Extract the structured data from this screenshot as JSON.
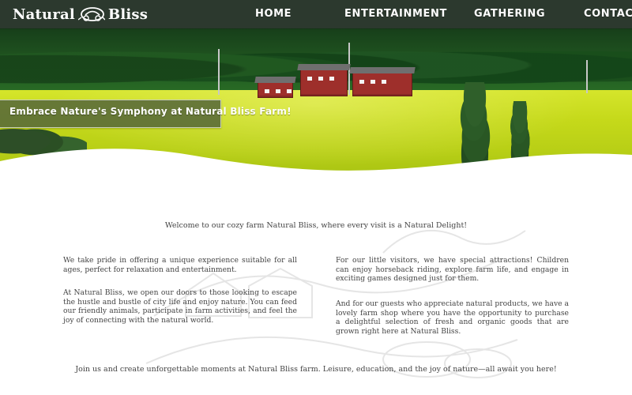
{
  "header": {
    "logo": {
      "left_text": "Natural",
      "right_text": "Bliss",
      "icon": "farm-wagon-icon"
    },
    "nav": [
      {
        "label": "HOME"
      },
      {
        "label": "ENTERTAINMENT"
      },
      {
        "label": "GATHERING"
      },
      {
        "label": "CONTACT"
      }
    ]
  },
  "hero": {
    "banner": "Embrace Nature's Symphony at Natural Bliss Farm!"
  },
  "content": {
    "welcome": "Welcome to our cozy farm Natural Bliss, where every visit is a Natural Delight!",
    "left_paragraphs": [
      "We take pride in offering a unique experience suitable for all ages, perfect for relaxation and entertainment.",
      "At Natural Bliss, we open our doors to those looking to escape the hustle and bustle of city life and enjoy nature. You can feed our friendly animals, participate in farm activities, and feel the joy of connecting with the natural world."
    ],
    "right_paragraphs": [
      "For our little visitors, we have special attractions! Children can enjoy horseback riding, explore farm life, and engage in exciting games designed just for them.",
      "And for our guests who appreciate natural products, we have a lovely farm shop where you have the opportunity to purchase a delightful selection of fresh and organic goods that are grown right here at Natural Bliss."
    ],
    "closing": "Join us and create unforgettable moments at Natural Bliss farm. Leisure, education, and the joy of nature—all await you here!"
  },
  "colors": {
    "header": "#2d392f",
    "banner": "#556739",
    "text": "#444444",
    "field": "#c5d91a",
    "forest": "#2a6e26"
  }
}
